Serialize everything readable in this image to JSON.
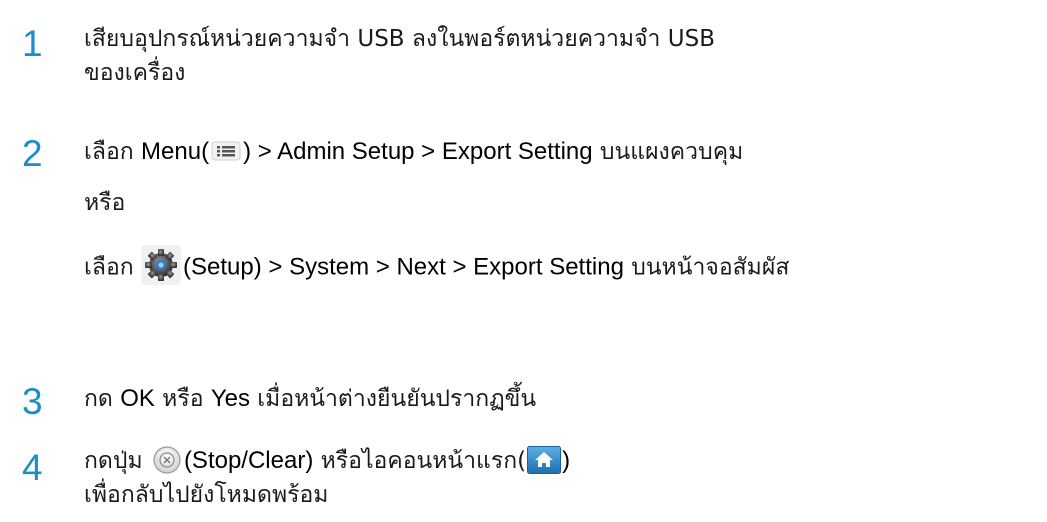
{
  "steps": [
    {
      "number": "1",
      "lines": [
        "เสียบอุปกรณ์หน่วยความจำ USB ลงในพอร์ตหน่วยความจำ USB",
        "ของเครื่อง"
      ]
    },
    {
      "number": "2",
      "line1": {
        "pre": "เลือก ",
        "menu": "Menu",
        "open_paren": "(",
        "close_paren": ")",
        "sep1": " > ",
        "admin": "Admin Setup",
        "sep2": " > ",
        "export": "Export Setting",
        "post": " บนแผงควบคุม"
      },
      "or_text": "หรือ",
      "line3": {
        "pre": "เลือก ",
        "setup": "(Setup)",
        "sep1": " > ",
        "system": "System",
        "sep2": " > ",
        "next": "Next",
        "sep3": " > ",
        "export": "Export Setting",
        "post": " บนหน้าจอสัมผัส"
      }
    },
    {
      "number": "3",
      "pre": "กด ",
      "ok": "OK",
      "mid": " หรือ ",
      "yes": "Yes",
      "post": " เมื่อหน้าต่างยืนยันปรากฏขึ้น"
    },
    {
      "number": "4",
      "pre": "กดปุ่ม ",
      "stop": "(Stop/Clear)",
      "mid": " หรือไอคอนหน้าแรก(",
      "close": ")",
      "line2": "เพื่อกลับไปยังโหมดพร้อม"
    }
  ],
  "icons": {
    "menu": "menu-icon",
    "setup": "gear-icon",
    "stop": "stop-clear-icon",
    "home": "home-icon"
  },
  "colors": {
    "step_number": "#1a8fc7",
    "text": "#1a1a1a"
  }
}
